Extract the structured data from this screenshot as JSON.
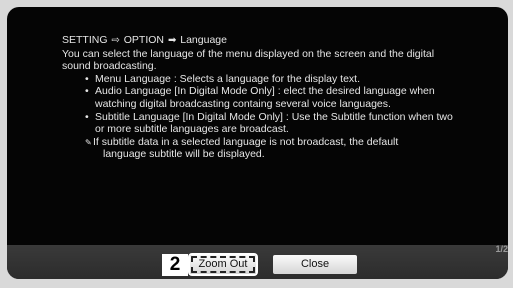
{
  "breadcrumb": {
    "setting": "SETTING",
    "option": "OPTION",
    "language": "Language"
  },
  "intro": {
    "line1": "You can select the language of the menu displayed on the screen and the digital",
    "line2": "sound broadcasting."
  },
  "bullets": [
    {
      "line1": "Menu Language : Selects a language for the display text."
    },
    {
      "line1": "Audio Language  [In Digital Mode Only] : elect the desired language when",
      "line2": "watching digital broadcasting containg several voice languages."
    },
    {
      "line1": "Subtitle Language [In Digital Mode Only] : Use the Subtitle function when two",
      "line2": "or more subtitle languages are broadcast."
    }
  ],
  "note": {
    "icon": "note-icon",
    "line1": "If subtitle data in a selected language is not broadcast, the default",
    "line2": "language subtitle will be displayed."
  },
  "footer": {
    "step": "2",
    "zoom_out_label": "Zoom Out",
    "close_label": "Close",
    "page_indicator": "1/2"
  }
}
